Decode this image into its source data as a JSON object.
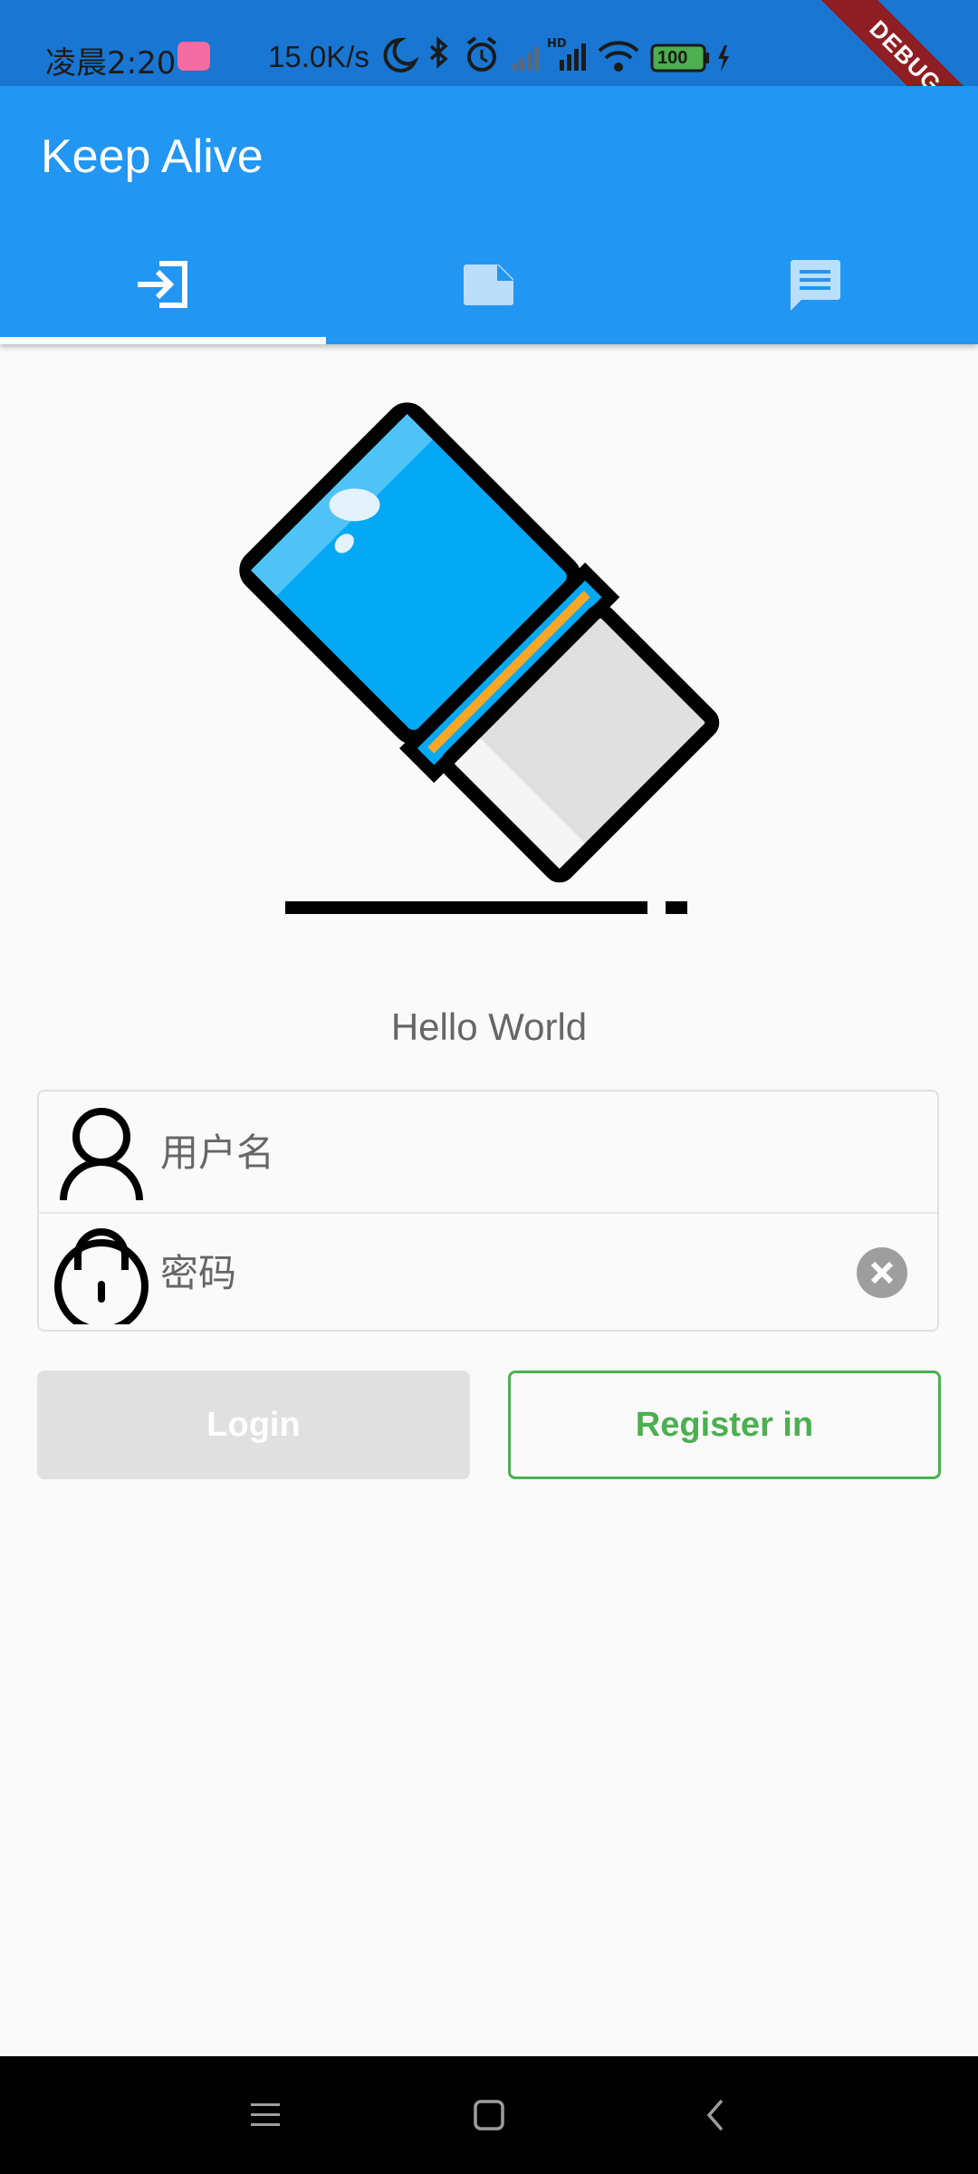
{
  "status_bar": {
    "time": "凌晨2:20",
    "network_speed": "15.0K/s",
    "battery": "100",
    "icons": [
      "bilibili-icon",
      "moon-icon",
      "bluetooth-icon",
      "alarm-icon",
      "signal-icon",
      "hd-signal-icon",
      "wifi-icon",
      "battery-icon",
      "charging-icon"
    ]
  },
  "debug_banner": "DEBUG",
  "app_bar": {
    "title": "Keep Alive",
    "tabs": [
      {
        "icon": "login-icon",
        "selected": true
      },
      {
        "icon": "note-icon",
        "selected": false
      },
      {
        "icon": "message-icon",
        "selected": false
      }
    ]
  },
  "main": {
    "logo_icon": "eraser-icon",
    "greeting": "Hello World",
    "username": {
      "placeholder": "用户名",
      "icon": "person-icon"
    },
    "password": {
      "placeholder": "密码",
      "icon": "lock-icon",
      "clear_icon": "clear-icon"
    },
    "login_label": "Login",
    "register_label": "Register in"
  },
  "nav_bar": [
    "menu-icon",
    "home-icon",
    "back-icon"
  ],
  "colors": {
    "app_bar": "#2196f3",
    "status_bar": "#1976d2",
    "register_accent": "#4caf50",
    "login_disabled": "#e0e0e0",
    "debug_banner": "#8e1e23"
  }
}
